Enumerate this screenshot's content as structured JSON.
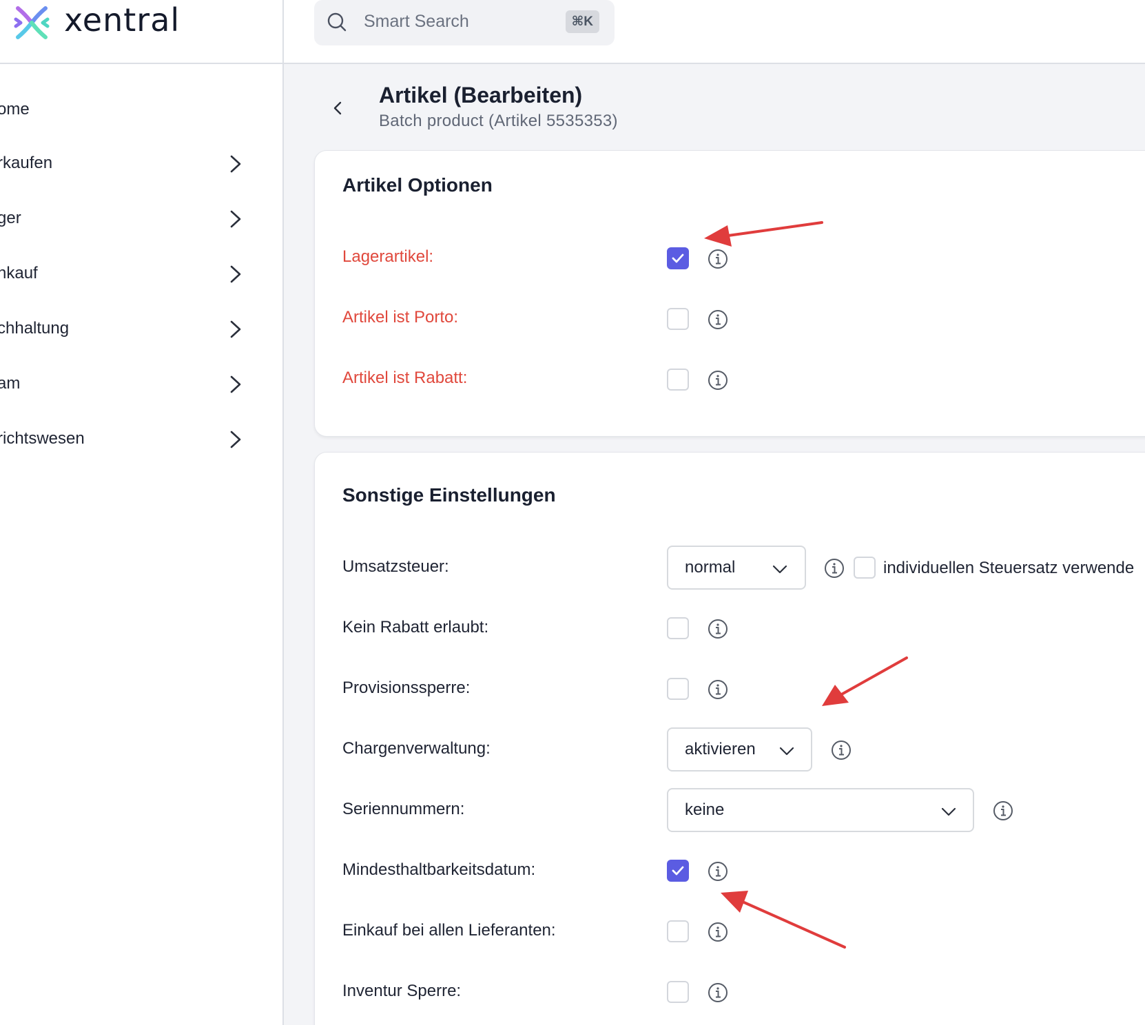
{
  "brand": {
    "name": "xentral"
  },
  "search": {
    "placeholder": "Smart Search",
    "shortcut": "⌘K"
  },
  "sidebar": {
    "items": [
      {
        "label": "ome",
        "has_chevron": false
      },
      {
        "label": "rkaufen",
        "has_chevron": true
      },
      {
        "label": "ger",
        "has_chevron": true
      },
      {
        "label": "nkauf",
        "has_chevron": true
      },
      {
        "label": "chhaltung",
        "has_chevron": true
      },
      {
        "label": "am",
        "has_chevron": true
      },
      {
        "label": "richtswesen",
        "has_chevron": true
      }
    ]
  },
  "header": {
    "title": "Artikel (Bearbeiten)",
    "subtitle": "Batch product (Artikel 5535353)"
  },
  "options_card": {
    "title": "Artikel Optionen",
    "rows": [
      {
        "label": "Lagerartikel:",
        "checked": true
      },
      {
        "label": "Artikel ist Porto:",
        "checked": false
      },
      {
        "label": "Artikel ist Rabatt:",
        "checked": false
      }
    ]
  },
  "settings_card": {
    "title": "Sonstige Einstellungen",
    "umsatzsteuer": {
      "label": "Umsatzsteuer:",
      "value": "normal",
      "individual_label": "individuellen Steuersatz verwende",
      "individual_checked": false
    },
    "kein_rabatt": {
      "label": "Kein Rabatt erlaubt:",
      "checked": false
    },
    "provisionssperre": {
      "label": "Provisionssperre:",
      "checked": false
    },
    "chargenverwaltung": {
      "label": "Chargenverwaltung:",
      "value": "aktivieren"
    },
    "seriennummern": {
      "label": "Seriennummern:",
      "value": "keine"
    },
    "mhd": {
      "label": "Mindesthaltbarkeitsdatum:",
      "checked": true
    },
    "einkauf_alle": {
      "label": "Einkauf bei allen Lieferanten:",
      "checked": false
    },
    "inventur_sperre": {
      "label": "Inventur Sperre:",
      "checked": false
    }
  },
  "colors": {
    "accent": "#5b5ce2",
    "required_label": "#e0483c",
    "annotation_arrow": "#e03c3c"
  },
  "icons": [
    "xentral-logo-icon",
    "search-icon",
    "chevron-right-icon",
    "chevron-left-icon",
    "info-icon",
    "checkmark-icon",
    "chevron-down-icon",
    "annotation-arrow"
  ]
}
